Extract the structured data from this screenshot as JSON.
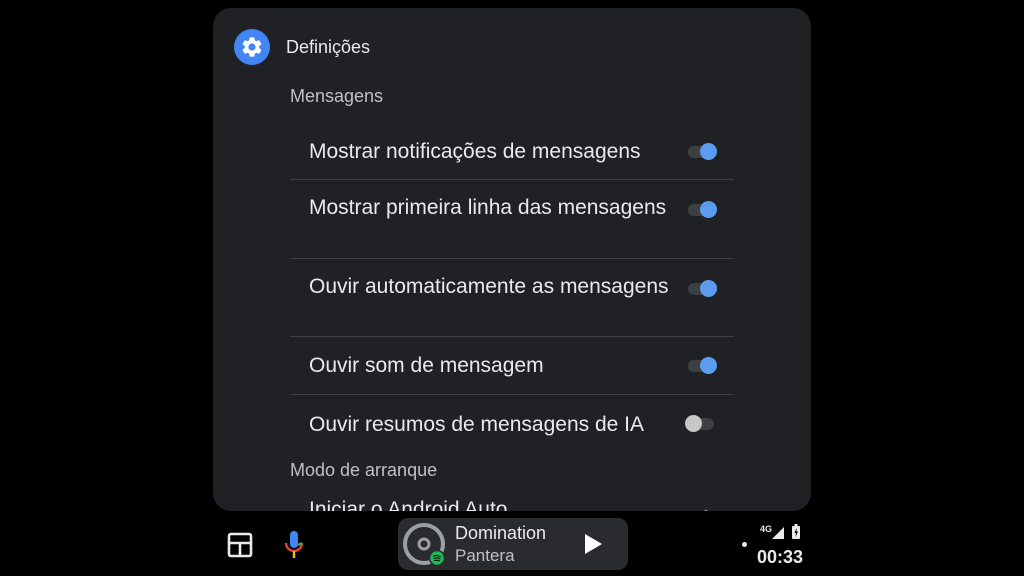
{
  "app": {
    "title": "Definições"
  },
  "sections": {
    "messages_label": "Mensagens",
    "startup_label": "Modo de arranque"
  },
  "settings": [
    {
      "label": "Mostrar notificações de mensagens",
      "enabled": true
    },
    {
      "label": "Mostrar primeira linha das mensagens",
      "enabled": true
    },
    {
      "label": "Ouvir automaticamente as mensagens",
      "enabled": true
    },
    {
      "label": "Ouvir som de mensagem",
      "enabled": true
    },
    {
      "label": "Ouvir resumos de mensagens de IA",
      "enabled": false
    }
  ],
  "startup_item": {
    "label": "Iniciar o Android Auto"
  },
  "media": {
    "title": "Domination",
    "artist": "Pantera",
    "state": "paused"
  },
  "status": {
    "network": "4G",
    "time": "00:33"
  },
  "colors": {
    "accent": "#4285f4",
    "toggle_on": "#5b9bf0",
    "panel_bg": "#202124",
    "spotify": "#1db954"
  },
  "icons": {
    "app": "gear-icon",
    "launcher": "app-grid-icon",
    "assistant": "microphone-icon",
    "play": "play-icon"
  }
}
